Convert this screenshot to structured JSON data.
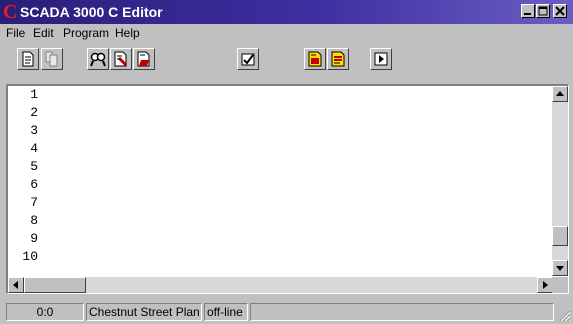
{
  "window": {
    "title": "SCADA 3000 C Editor",
    "logo_letter": "C",
    "logo_color": "#e02020",
    "titlebar_color": "#2a1e7a",
    "controls": [
      "minimize-icon",
      "maximize-icon",
      "close-icon"
    ]
  },
  "menu": {
    "items": [
      "File",
      "Edit",
      "Program",
      "Help"
    ]
  },
  "toolbar": {
    "buttons": [
      {
        "icon": "new-file-icon"
      },
      {
        "icon": "copy-file-icon"
      },
      {
        "icon": "search-icon"
      },
      {
        "icon": "edit-file-icon"
      },
      {
        "icon": "open-file-icon"
      },
      {
        "icon": "check-icon"
      },
      {
        "icon": "compile-icon"
      },
      {
        "icon": "download-icon"
      },
      {
        "icon": "run-icon"
      }
    ]
  },
  "editor": {
    "line_numbers": [
      "1",
      "2",
      "3",
      "4",
      "5",
      "6",
      "7",
      "8",
      "9",
      "10"
    ],
    "content": ""
  },
  "status": {
    "position": "0:0",
    "plant": "Chestnut Street Plan",
    "connection": "off-line"
  }
}
